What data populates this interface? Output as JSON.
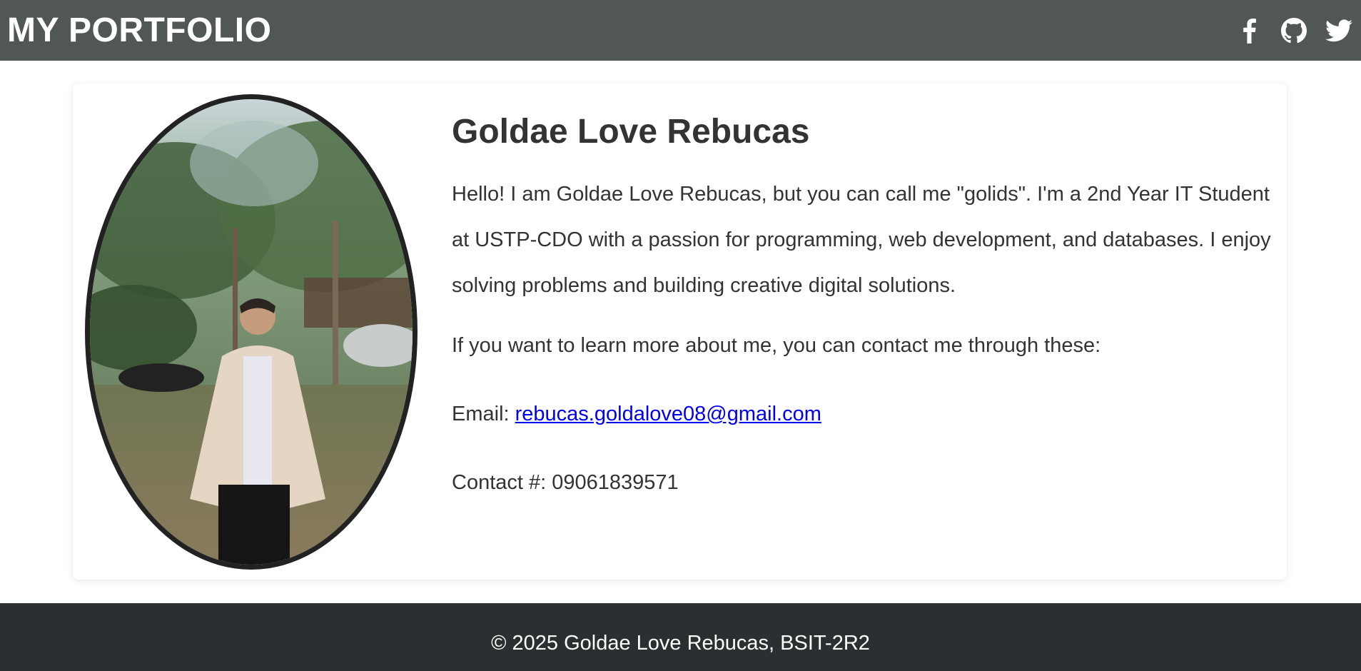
{
  "header": {
    "brand": "MY PORTFOLIO",
    "social": [
      {
        "name": "facebook",
        "icon": "facebook-icon"
      },
      {
        "name": "github",
        "icon": "github-icon"
      },
      {
        "name": "twitter",
        "icon": "twitter-icon"
      }
    ]
  },
  "profile": {
    "photo_alt": "profile-photo",
    "name": "Goldae Love Rebucas",
    "bio": "Hello! I am Goldae Love Rebucas, but you can call me \"golids\". I'm a 2nd Year IT Student at USTP-CDO with a passion for programming, web development, and databases. I enjoy solving problems and building creative digital solutions.",
    "contact_intro": "If you want to learn more about me, you can contact me through these:",
    "email_label": "Email: ",
    "email": "rebucas.goldalove08@gmail.com",
    "contact_label": "Contact #: ",
    "contact_number": "09061839571"
  },
  "footer": {
    "text": "© 2025 Goldae Love Rebucas, BSIT-2R2"
  },
  "colors": {
    "header_bg": "#515657",
    "footer_bg": "#2a2f31",
    "text": "#333333",
    "link": "#0000ee"
  }
}
